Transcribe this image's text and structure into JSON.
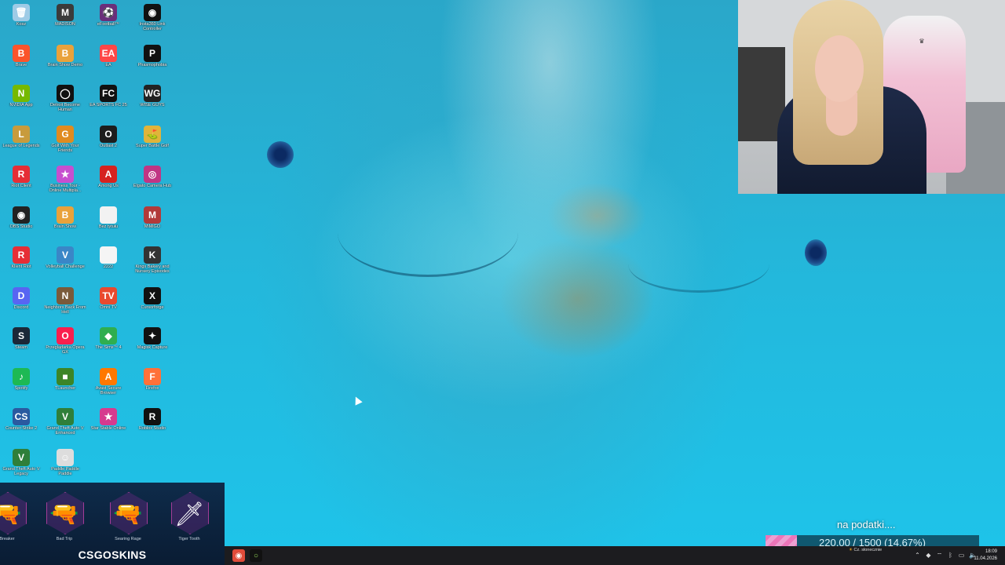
{
  "desktop": {
    "icons": [
      {
        "label": "Kosz",
        "icon": "recycle-bin-icon",
        "glyph": "🗑",
        "color": "#9ecbe6"
      },
      {
        "label": "MADISON",
        "icon": "madison-icon",
        "glyph": "M",
        "color": "#3b3b3b"
      },
      {
        "label": "eFootball™",
        "icon": "efootball-icon",
        "glyph": "⚽",
        "color": "#6a2f7a"
      },
      {
        "label": "Insta360 Link Controller",
        "icon": "insta360-icon",
        "glyph": "◉",
        "color": "#111"
      },
      {
        "label": "Brave",
        "icon": "brave-icon",
        "glyph": "B",
        "color": "#fb542b"
      },
      {
        "label": "Brain Show Demo",
        "icon": "brain-show-icon",
        "glyph": "B",
        "color": "#e9a23b"
      },
      {
        "label": "EA",
        "icon": "ea-icon",
        "glyph": "EA",
        "color": "#ff4747"
      },
      {
        "label": "Phasmophobia",
        "icon": "phasmophobia-icon",
        "glyph": "P",
        "color": "#111"
      },
      {
        "label": "NVIDIA App",
        "icon": "nvidia-icon",
        "glyph": "N",
        "color": "#76b900"
      },
      {
        "label": "Detroit Become Human",
        "icon": "detroit-icon",
        "glyph": "◯",
        "color": "#111"
      },
      {
        "label": "EA SPORTS FC 25",
        "icon": "fc25-icon",
        "glyph": "FC",
        "color": "#111"
      },
      {
        "label": "WISE GUYS",
        "icon": "wise-guys-icon",
        "glyph": "WG",
        "color": "#222"
      },
      {
        "label": "League of Legends",
        "icon": "lol-icon",
        "glyph": "L",
        "color": "#c89b3c"
      },
      {
        "label": "Golf With Your Friends",
        "icon": "golf-icon",
        "glyph": "G",
        "color": "#e08b1f"
      },
      {
        "label": "Outlast 2",
        "icon": "outlast-icon",
        "glyph": "O",
        "color": "#1d1d1d"
      },
      {
        "label": "Super Battle Golf",
        "icon": "battle-golf-icon",
        "glyph": "⛳",
        "color": "#e0b43a"
      },
      {
        "label": "Riot Client",
        "icon": "riot-icon",
        "glyph": "R",
        "color": "#e62e36"
      },
      {
        "label": "Business Tour - Online Multipla...",
        "icon": "business-tour-icon",
        "glyph": "★",
        "color": "#c74fcf"
      },
      {
        "label": "Among Us",
        "icon": "among-us-icon",
        "glyph": "A",
        "color": "#d6231f"
      },
      {
        "label": "Elgato Camera Hub",
        "icon": "elgato-icon",
        "glyph": "◎",
        "color": "#c13584"
      },
      {
        "label": "OBS Studio",
        "icon": "obs-icon",
        "glyph": "◉",
        "color": "#222"
      },
      {
        "label": "Brain Show",
        "icon": "brain-show-2-icon",
        "glyph": "B",
        "color": "#e9a23b"
      },
      {
        "label": "Bez tytułu",
        "icon": "blank-file-icon",
        "glyph": "",
        "color": "#f2f2f2"
      },
      {
        "label": "MiMiGO",
        "icon": "mimigo-icon",
        "glyph": "M",
        "color": "#b23a3a"
      },
      {
        "label": "Klient Riot",
        "icon": "riot-client-2-icon",
        "glyph": "R",
        "color": "#e62e36"
      },
      {
        "label": "Volleyball Challenge",
        "icon": "volleyball-icon",
        "glyph": "V",
        "color": "#3a86c7"
      },
      {
        "label": "2222",
        "icon": "text-file-icon",
        "glyph": "",
        "color": "#f5f5f5"
      },
      {
        "label": "Kings Bakery and Nursery Episodes",
        "icon": "kings-bakery-icon",
        "glyph": "K",
        "color": "#333"
      },
      {
        "label": "Discord",
        "icon": "discord-icon",
        "glyph": "D",
        "color": "#5865f2"
      },
      {
        "label": "Neighbors Back From Hell",
        "icon": "neighbors-icon",
        "glyph": "N",
        "color": "#7a5a3a"
      },
      {
        "label": "Omni TV",
        "icon": "omni-tv-icon",
        "glyph": "TV",
        "color": "#e94a2e"
      },
      {
        "label": "Cursorforge",
        "icon": "cursorforge-icon",
        "glyph": "X",
        "color": "#111"
      },
      {
        "label": "Steam",
        "icon": "steam-icon",
        "glyph": "S",
        "color": "#1b2838"
      },
      {
        "label": "Przeglądarka Opera GX",
        "icon": "opera-gx-icon",
        "glyph": "O",
        "color": "#fa1e4e"
      },
      {
        "label": "The Sims™ 4",
        "icon": "sims-icon",
        "glyph": "◆",
        "color": "#2fae4f"
      },
      {
        "label": "Magisk Capture",
        "icon": "magisk-capture-icon",
        "glyph": "✦",
        "color": "#111"
      },
      {
        "label": "Spotify",
        "icon": "spotify-icon",
        "glyph": "♪",
        "color": "#1db954"
      },
      {
        "label": "TLauncher",
        "icon": "tlauncher-icon",
        "glyph": "■",
        "color": "#3c8527"
      },
      {
        "label": "Avast Secure Browser",
        "icon": "avast-browser-icon",
        "glyph": "A",
        "color": "#ff7800"
      },
      {
        "label": "Firefox",
        "icon": "firefox-icon",
        "glyph": "F",
        "color": "#ff7139"
      },
      {
        "label": "Counter-Strike 2",
        "icon": "cs2-icon",
        "glyph": "CS",
        "color": "#2a5aa0"
      },
      {
        "label": "Grand Theft Auto V Enhanced",
        "icon": "gtav-enhanced-icon",
        "glyph": "V",
        "color": "#2f7f3a"
      },
      {
        "label": "Star Stable Online",
        "icon": "star-stable-icon",
        "glyph": "★",
        "color": "#d63a8f"
      },
      {
        "label": "Roblox Studio",
        "icon": "roblox-studio-icon",
        "glyph": "R",
        "color": "#111"
      },
      {
        "label": "Grand Theft Auto V Legacy",
        "icon": "gtav-legacy-icon",
        "glyph": "V",
        "color": "#2f7f3a"
      },
      {
        "label": "Paddle Paddle Paddle",
        "icon": "paddle-icon",
        "glyph": "☺",
        "color": "#ddd"
      }
    ]
  },
  "overlay": {
    "skins": [
      {
        "name": "Breaker",
        "icon": "weapon-skin-breaker-icon",
        "glyph": "🔫"
      },
      {
        "name": "Bad Trip",
        "icon": "weapon-skin-bad-trip-icon",
        "glyph": "🔫"
      },
      {
        "name": "Searing Rage",
        "icon": "weapon-skin-searing-rage-icon",
        "glyph": "🔫"
      },
      {
        "name": "Tiger Tooth",
        "icon": "weapon-skin-tiger-tooth-icon",
        "glyph": "🗡"
      }
    ],
    "brand": "CSGOSKINS"
  },
  "goal": {
    "title": "na podatki....",
    "label": "220.00 / 1500 (14.67%)",
    "fraction": 0.1467,
    "fill_color": "#ff6fb5"
  },
  "taskbar": {
    "weather": "Cz. słonecznie",
    "time": "18:09",
    "date": "11.04.2026"
  }
}
